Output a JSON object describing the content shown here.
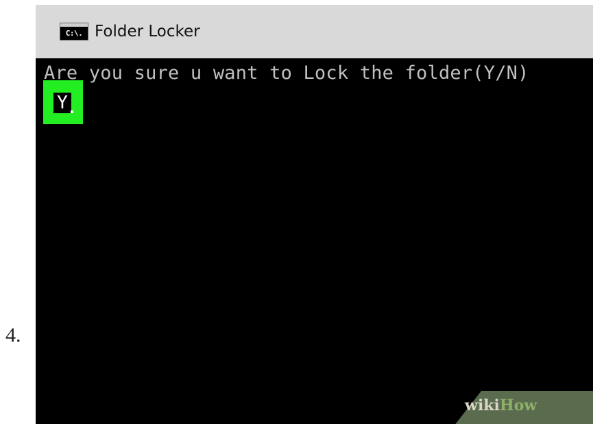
{
  "step": {
    "number": "4."
  },
  "window": {
    "title": "Folder Locker",
    "icon": "cmd-console-icon",
    "icon_text": "C:\\."
  },
  "console": {
    "prompt": "Are you sure u want to Lock the folder(Y/N)",
    "input": "Y",
    "highlight_color": "#22ee22",
    "background_color": "#000000",
    "text_color": "#c0c0c0"
  },
  "watermark": {
    "part1": "wiki",
    "part2": "How"
  }
}
